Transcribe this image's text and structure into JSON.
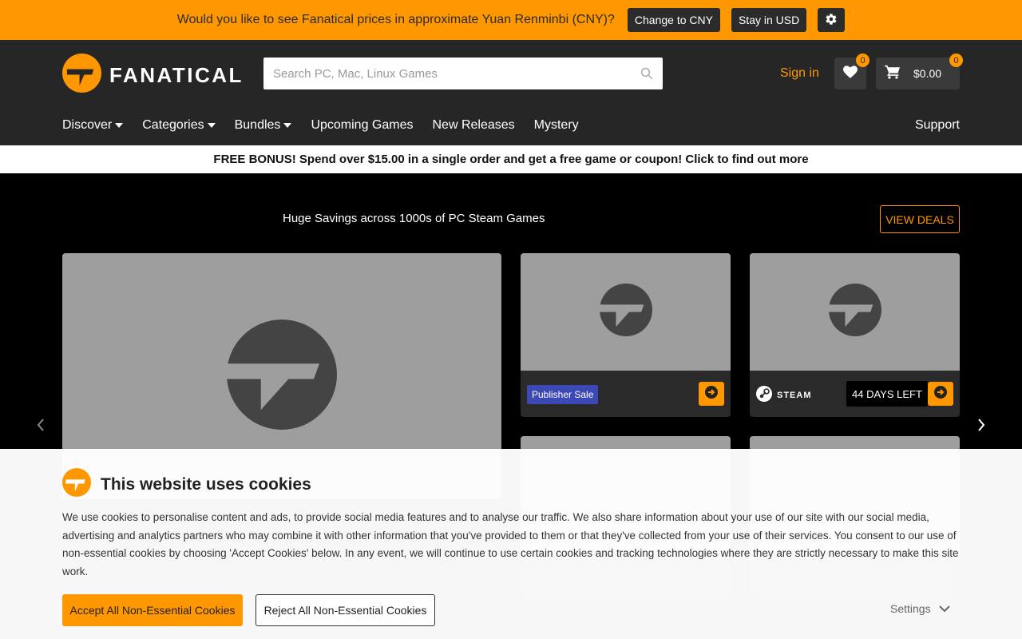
{
  "currency_banner": {
    "message": "Would you like to see Fanatical prices in approximate Yuan Renminbi (CNY)?",
    "change_label": "Change to CNY",
    "stay_label": "Stay in USD",
    "settings_icon": "gear-icon"
  },
  "header": {
    "logo_text": "FANATICAL",
    "search_placeholder": "Search PC, Mac, Linux Games",
    "sign_in": "Sign in",
    "wishlist_count": "0",
    "cart_count": "0",
    "cart_total": "$0.00"
  },
  "nav": {
    "items": [
      {
        "label": "Discover",
        "dropdown": true
      },
      {
        "label": "Categories",
        "dropdown": true
      },
      {
        "label": "Bundles",
        "dropdown": true
      },
      {
        "label": "Upcoming Games",
        "dropdown": false
      },
      {
        "label": "New Releases",
        "dropdown": false
      },
      {
        "label": "Mystery",
        "dropdown": false
      }
    ],
    "support": "Support"
  },
  "bonus_banner": "FREE BONUS! Spend over $15.00 in a single order and get a free game or coupon! Click to find out more",
  "hero": {
    "title": "Huge Savings across 1000s of PC Steam Games",
    "view_deals": "VIEW DEALS",
    "card_1": {
      "badge": "Publisher Sale"
    },
    "card_2": {
      "platform": "STEAM",
      "days_left": "44 DAYS LEFT"
    }
  },
  "cookie_banner": {
    "title": "This website uses cookies",
    "text": "We use cookies to personalise content and ads, to provide social media features and to analyse our traffic. We also share information about your use of our site with our social media, advertising and analytics partners who may combine it with other information that you've provided to them or that they've collected from your use of their services. You consent to our use of non-essential cookies by choosing 'Accept Cookies' below. In any event, we will continue to use certain cookies and tracking technologies where they are strictly necessary to make this site work.",
    "accept_label": "Accept All Non-Essential Cookies",
    "reject_label": "Reject All Non-Essential Cookies",
    "settings_label": "Settings"
  },
  "colors": {
    "brand_orange": "#ff9800",
    "header_bg": "#262626",
    "placeholder_grey": "#9e9e9e",
    "publisher_badge": "#3c48b4"
  }
}
